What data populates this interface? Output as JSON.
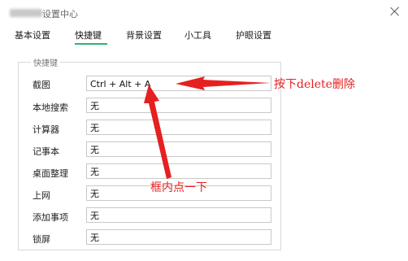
{
  "window": {
    "title": "设置中心"
  },
  "tabs": [
    {
      "label": "基本设置"
    },
    {
      "label": "快捷键"
    },
    {
      "label": "背景设置"
    },
    {
      "label": "小工具"
    },
    {
      "label": "护眼设置"
    }
  ],
  "active_tab": "快捷键",
  "group": {
    "legend": "快捷键"
  },
  "rows": [
    {
      "label": "截图",
      "value": "Ctrl + Alt + A"
    },
    {
      "label": "本地搜索",
      "value": "无"
    },
    {
      "label": "计算器",
      "value": "无"
    },
    {
      "label": "记事本",
      "value": "无"
    },
    {
      "label": "桌面整理",
      "value": "无"
    },
    {
      "label": "上网",
      "value": "无"
    },
    {
      "label": "添加事项",
      "value": "无"
    },
    {
      "label": "锁屏",
      "value": "无"
    }
  ],
  "annotations": {
    "top": "按下delete删除",
    "middle": "框内点一下",
    "color": "#e62020"
  },
  "colors": {
    "accent": "#2bb673"
  }
}
